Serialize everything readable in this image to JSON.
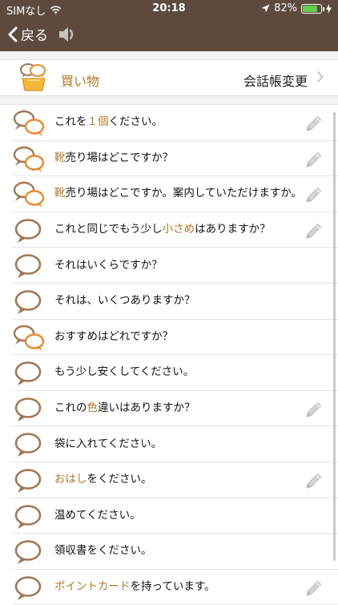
{
  "status": {
    "carrier": "SIMなし",
    "time": "20:18",
    "battery": "82%",
    "battery_level": 0.82
  },
  "nav": {
    "back_label": "戻る"
  },
  "category": {
    "title": "買い物",
    "action": "会話帳変更"
  },
  "colors": {
    "brand": "#5e4a3c",
    "accent": "#b07a2c",
    "orange": "#e98a2c"
  },
  "phrases": [
    {
      "a": "これを",
      "b": "１個",
      "c": "ください。",
      "icon": "double-bubble",
      "edit": true
    },
    {
      "a": "",
      "b": "靴",
      "c": "売り場はどこですか？",
      "icon": "double-bubble",
      "edit": true
    },
    {
      "a": "",
      "b": "靴",
      "c": "売り場はどこですか。案内していただけますか。",
      "icon": "double-bubble",
      "edit": true
    },
    {
      "a": "これと同じでもう少し",
      "b": "小さめ",
      "c": "はありますか？",
      "icon": "single-bubble",
      "edit": true
    },
    {
      "a": "それはいくらですか？",
      "b": "",
      "c": "",
      "icon": "single-bubble",
      "edit": false
    },
    {
      "a": "それは、いくつありますか？",
      "b": "",
      "c": "",
      "icon": "single-bubble",
      "edit": false
    },
    {
      "a": "おすすめはどれですか？",
      "b": "",
      "c": "",
      "icon": "double-bubble",
      "edit": false
    },
    {
      "a": "もう少し安くしてください。",
      "b": "",
      "c": "",
      "icon": "single-bubble",
      "edit": false
    },
    {
      "a": "これの",
      "b": "色",
      "c": "違いはありますか？",
      "icon": "single-bubble",
      "edit": true
    },
    {
      "a": "袋に入れてください。",
      "b": "",
      "c": "",
      "icon": "single-bubble",
      "edit": false
    },
    {
      "a": "",
      "b": "おはし",
      "c": "をください。",
      "icon": "single-bubble",
      "edit": true
    },
    {
      "a": "温めてください。",
      "b": "",
      "c": "",
      "icon": "single-bubble",
      "edit": false
    },
    {
      "a": "領収書をください。",
      "b": "",
      "c": "",
      "icon": "single-bubble",
      "edit": false
    },
    {
      "a": "",
      "b": "ポイントカード",
      "c": "を持っています。",
      "icon": "single-bubble",
      "edit": true
    }
  ]
}
